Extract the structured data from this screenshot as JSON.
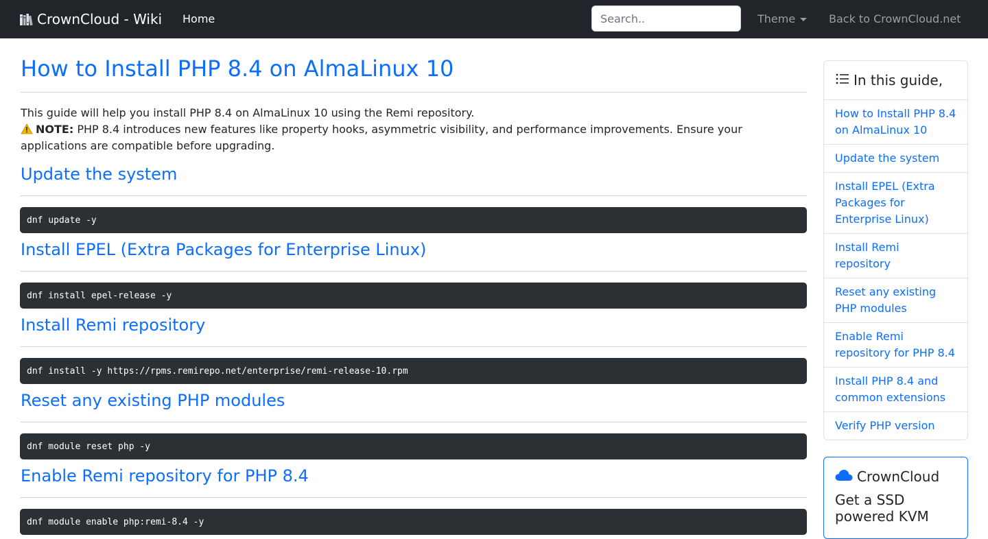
{
  "navbar": {
    "brand": "CrownCloud - Wiki",
    "home": "Home",
    "search_placeholder": "Search..",
    "theme": "Theme",
    "back": "Back to CrownCloud.net"
  },
  "article": {
    "title": "How to Install PHP 8.4 on AlmaLinux 10",
    "intro": "This guide will help you install PHP 8.4 on AlmaLinux 10 using the Remi repository.",
    "note_label": "NOTE:",
    "note_text": " PHP 8.4 introduces new features like property hooks, asymmetric visibility, and performance improvements. Ensure your applications are compatible before upgrading.",
    "sections": [
      {
        "heading": "Update the system",
        "code": "dnf update -y"
      },
      {
        "heading": "Install EPEL (Extra Packages for Enterprise Linux)",
        "code": "dnf install epel-release -y"
      },
      {
        "heading": "Install Remi repository",
        "code": "dnf install -y https://rpms.remirepo.net/enterprise/remi-release-10.rpm"
      },
      {
        "heading": "Reset any existing PHP modules",
        "code": "dnf module reset php -y"
      },
      {
        "heading": "Enable Remi repository for PHP 8.4",
        "code": "dnf module enable php:remi-8.4 -y"
      }
    ]
  },
  "toc": {
    "heading": "In this guide,",
    "items": [
      "How to Install PHP 8.4 on AlmaLinux 10",
      "Update the system",
      "Install EPEL (Extra Packages for Enterprise Linux)",
      "Install Remi repository",
      "Reset any existing PHP modules",
      "Enable Remi repository for PHP 8.4",
      "Install PHP 8.4 and common extensions",
      "Verify PHP version"
    ]
  },
  "promo": {
    "brand": "CrownCloud",
    "tagline": "Get a SSD powered KVM"
  },
  "colors": {
    "navbar_bg": "#212529",
    "link": "#0d6efd",
    "code_bg": "#2b3035"
  },
  "icons": {
    "brand": "books-icon",
    "note": "warning-icon",
    "toc": "list-icon",
    "promo": "cloud-icon"
  }
}
